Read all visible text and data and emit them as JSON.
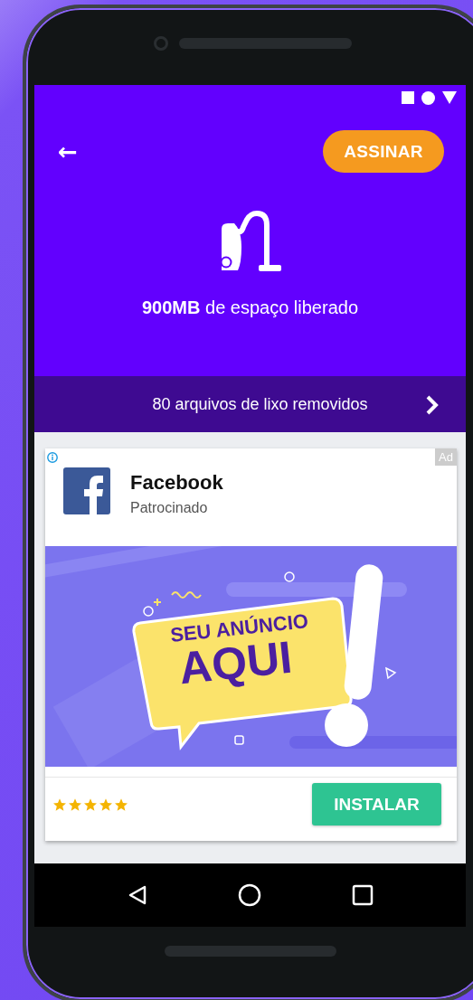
{
  "header": {
    "back_button": "←",
    "subscribe_button": "ASSINAR"
  },
  "summary": {
    "text": "**900MB** de espaço liberado"
  },
  "removed_bar": {
    "text": "80 arquivos de lixo removidos"
  },
  "ad": {
    "badge": "Ad",
    "advertiser": "Facebook",
    "label": "Patrocinado",
    "banner": {
      "headline": "SEU ANÚNCIO",
      "big_text": "AQUI"
    },
    "stars": 5,
    "button": "INSTALAR"
  }
}
